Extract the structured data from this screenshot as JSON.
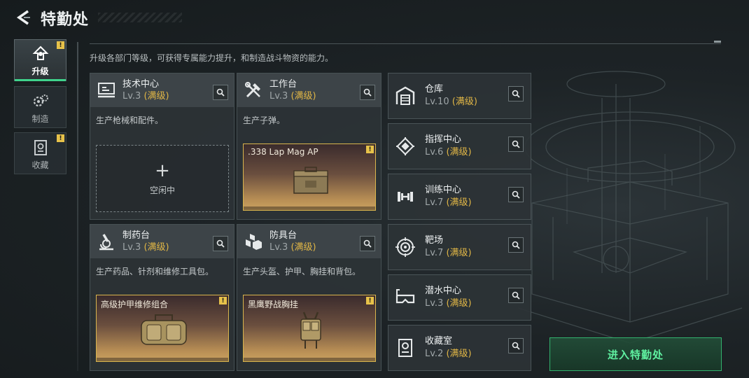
{
  "header": {
    "title": "特勤处"
  },
  "sidebar": {
    "tabs": [
      {
        "label": "升级",
        "active": true,
        "warning": "!"
      },
      {
        "label": "制造",
        "active": false,
        "warning": ""
      },
      {
        "label": "收藏",
        "active": false,
        "warning": "!"
      }
    ]
  },
  "intro": "升级各部门等级，可获得专属能力提升，和制造战斗物资的能力。",
  "max_label": "(满级)",
  "departments": [
    {
      "name": "技术中心",
      "level": "Lv.3",
      "desc": "生产枪械和配件。",
      "slot": {
        "state": "idle",
        "plus": "+",
        "text": "空闲中"
      },
      "icon": "monitor-icon"
    },
    {
      "name": "工作台",
      "level": "Lv.3",
      "desc": "生产子弹。",
      "slot": {
        "state": "item",
        "item": ".338 Lap Mag AP",
        "warning": "!"
      },
      "icon": "tools-icon"
    },
    {
      "name": "制药台",
      "level": "Lv.3",
      "desc": "生产药品、针剂和维修工具包。",
      "slot": {
        "state": "item",
        "item": "高级护甲维修组合",
        "warning": "!"
      },
      "icon": "microscope-icon"
    },
    {
      "name": "防具台",
      "level": "Lv.3",
      "desc": "生产头盔、护甲、胸挂和背包。",
      "slot": {
        "state": "item",
        "item": "黑鹰野战胸挂",
        "warning": "!"
      },
      "icon": "armor-blocks-icon"
    }
  ],
  "small_departments": [
    {
      "name": "仓库",
      "level": "Lv.10",
      "icon": "warehouse-icon"
    },
    {
      "name": "指挥中心",
      "level": "Lv.6",
      "icon": "chip-icon"
    },
    {
      "name": "训练中心",
      "level": "Lv.7",
      "icon": "dumbbell-icon"
    },
    {
      "name": "靶场",
      "level": "Lv.7",
      "icon": "target-icon"
    },
    {
      "name": "潜水中心",
      "level": "Lv.3",
      "icon": "diving-mask-icon"
    },
    {
      "name": "收藏室",
      "level": "Lv.2",
      "icon": "collection-icon"
    }
  ],
  "enter_button": "进入特勤处",
  "colors": {
    "accent_green": "#3fd38c",
    "max_gold": "#e0b646",
    "warning": "#e7c24a"
  }
}
